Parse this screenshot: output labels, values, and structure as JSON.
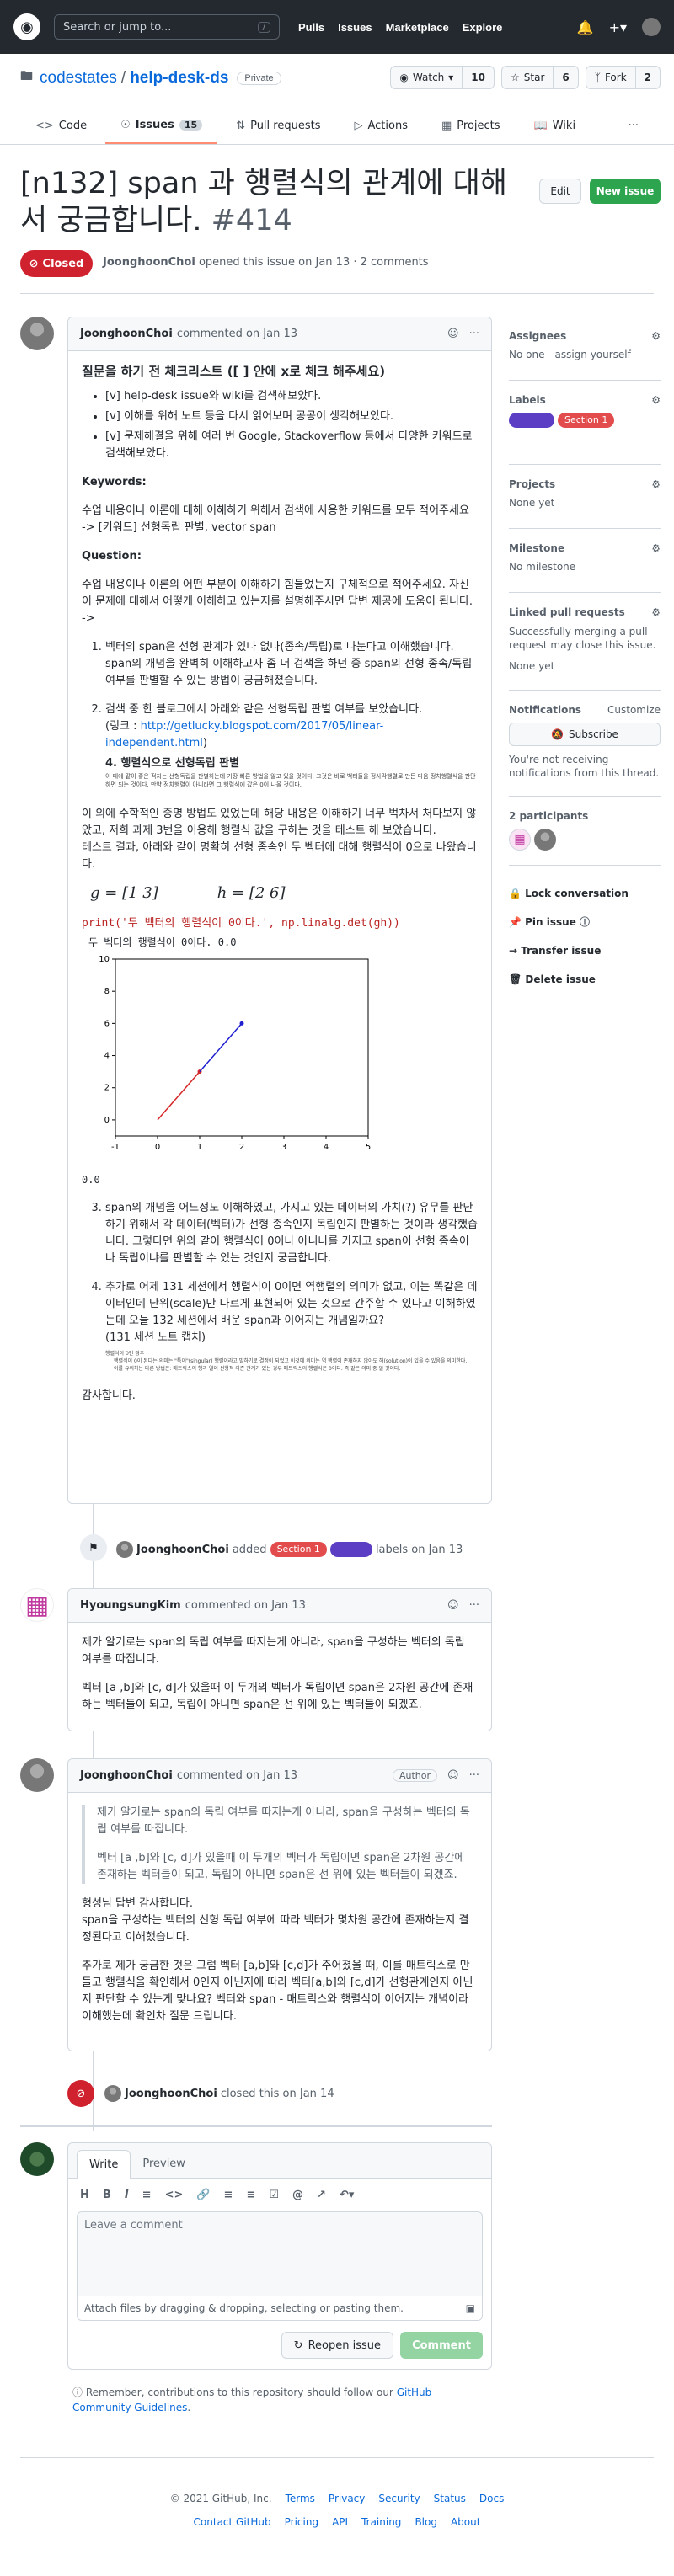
{
  "header": {
    "search_placeholder": "Search or jump to...",
    "slash": "/",
    "nav": [
      "Pulls",
      "Issues",
      "Marketplace",
      "Explore"
    ]
  },
  "repo": {
    "owner": "codestates",
    "name": "help-desk-ds",
    "visibility": "Private",
    "watch": "Watch",
    "watch_count": "10",
    "star": "Star",
    "star_count": "6",
    "fork": "Fork",
    "fork_count": "2"
  },
  "tabs": {
    "code": "Code",
    "issues": "Issues",
    "issues_count": "15",
    "pulls": "Pull requests",
    "actions": "Actions",
    "projects": "Projects",
    "wiki": "Wiki"
  },
  "issue": {
    "title": "[n132] span 과 행렬식의 관계에 대해서 궁금합니다.",
    "number": "#414",
    "state": "Closed",
    "author": "JoonghoonChoi",
    "meta": "opened this issue on Jan 13 · 2 comments",
    "edit": "Edit",
    "new_issue": "New issue"
  },
  "c1": {
    "author": "JoonghoonChoi",
    "when": "commented on Jan 13",
    "h": "질문을 하기 전 체크리스트 ([ ] 안에 x로 체크 해주세요)",
    "check": [
      "[v] help-desk issue와 wiki를 검색해보았다.",
      "[v] 이해를 위해 노트 등을 다시 읽어보며 공공이 생각해보았다.",
      "[v] 문제해결을 위해 여러 번 Google, Stackoverflow 등에서 다양한 키워드로 검색해보았다."
    ],
    "kw_h": "Keywords:",
    "kw_1": "수업 내용이나 이론에 대해 이해하기 위해서 검색에 사용한 키워드를 모두 적어주세요",
    "kw_2": "-> [키워드] 선형독립 판별, vector span",
    "q_h": "Question:",
    "q_p1": "수업 내용이나 이론의 어떤 부분이 이해하기 힘들었는지 구체적으로 적어주세요. 자신이 문제에 대해서 어떻게 이해하고 있는지를 설명해주시면 답변 제공에 도움이 됩니다.",
    "q_arrow": "->",
    "o1": "벡터의 span은 선형 관계가 있나 없나(종속/독립)로 나눈다고 이해했습니다. span의 개념을 완벽히 이해하고자 좀 더 검색을 하던 중 span의 선형 종속/독립 여부를 판별할 수 있는 방법이 궁금해졌습니다.",
    "o2a": "검색 중 한 블로그에서 아래와 같은 선형독립 판별 여부를 보았습니다.",
    "o2b": "(링크 : ",
    "o2link": "http://getlucky.blogspot.com/2017/05/linear-independent.html",
    "o2c": ")",
    "o2img_h": "4. 행렬식으로 선형독립 판별",
    "o2img_t": "이 때에 같이 좋은 적지는 선형독립을 판별하는데 가장 빠른 방법을 알고 있을 것이다. 그것은 바로 백터들을 정사각행렬로 만든 다음 정치행렬식을 판단하면 되는 것이다. 만약 정치행렬이 아니라면 그 행렬식에 값은 0이 나올 것이다.",
    "p3": "이 외에 수학적인 증명 방법도 있었는데 해당 내용은 이해하기 너무 벅차서 처다보지 않았고, 저희 과제 3번을 이용해 행렬식 값을 구하는 것을 테스트 해 보았습니다.",
    "p4": "테스트 결과, 아래와 같이 명확히 선형 종속인 두 벡터에 대해 행렬식이 0으로 나왔습니다.",
    "vec_g": "g = [1   3]",
    "vec_h": "h = [2   6]",
    "code": "print('두 벡터의 행렬식이 0이다.', np.linalg.det(gh))",
    "out": "두 벡터의 행렬식이 0이다. 0.0",
    "out2": "0.0",
    "o3": "span의 개념을 어느정도 이해하였고, 가지고 있는 데이터의 가치(?) 유무를 판단하기 위해서 각 데이터(벡터)가 선형 종속인지 독립인지 판별하는 것이라 생각했습니다. 그렇다면 위와 같이 행렬식이 0이나 아니나를 가지고 span이 선형 종속이나 독립이냐를 판별할 수 있는 것인지 궁금합니다.",
    "o4": "추가로 어제 131 세션에서 행렬식이 0이면 역행렬의 의미가 없고, 이는 똑같은 데이터인데 단위(scale)만 다르게 표현되어 있는 것으로 간주할 수 있다고 이해하였는데 오늘 132 세션에서 배운 span과 이어지는 개념일까요?",
    "o4b": "(131 세션 노트 캡처)",
    "o4img_a": "행렬식이 0인 경우",
    "o4img_b": "행렬식이 0이 된다는 의미는 \"특이\"(singular) 행렬이라고 말하기로 결정이 되었고 이것에 의미는 역 행렬이 존재하지 않아도 해(solution)이 있을 수 있음을 의미한다.",
    "o4img_c": "이를 유의하는 다른 방법은: 매트릭스의 행과 열이 선형적 의존 관계가 있는 경우 매트릭스의 행렬식은 0이다. 즉 같은 의미 중 일 것이다.",
    "thanks": "감사합니다."
  },
  "chart_data": {
    "type": "line",
    "xlim": [
      -1,
      5
    ],
    "ylim": [
      -1,
      10
    ],
    "xticks": [
      -1,
      0,
      1,
      2,
      3,
      4,
      5
    ],
    "yticks": [
      0,
      2,
      4,
      6,
      8,
      10
    ],
    "series": [
      {
        "color": "#d62728",
        "x": [
          0,
          1
        ],
        "y": [
          0,
          3
        ]
      },
      {
        "color": "#1f1fd0",
        "x": [
          1,
          2
        ],
        "y": [
          3,
          6
        ]
      }
    ]
  },
  "sidebar": {
    "assignees": "Assignees",
    "assignees_v": "No one—assign yourself",
    "labels": "Labels",
    "label1": "",
    "label2": "Section 1",
    "projects": "Projects",
    "projects_v": "None yet",
    "milestone": "Milestone",
    "milestone_v": "No milestone",
    "linked": "Linked pull requests",
    "linked_t": "Successfully merging a pull request may close this issue.",
    "linked_v": "None yet",
    "notif": "Notifications",
    "customize": "Customize",
    "subscribe": "Subscribe",
    "notif_t": "You're not receiving notifications from this thread.",
    "participants": "2 participants",
    "lock": "Lock conversation",
    "pin": "Pin issue",
    "transfer": "Transfer issue",
    "delete": "Delete issue"
  },
  "ev1": {
    "author": "JoonghoonChoi",
    "a": "added",
    "l1": "Section 1",
    "l2": "",
    "b": "labels on Jan 13"
  },
  "c2": {
    "author": "HyoungsungKim",
    "when": "commented on Jan 13",
    "p1": "제가 알기로는 span의 독립 여부를 따지는게 아니라, span을 구성하는 벡터의 독립 여부를 따집니다.",
    "p2": "벡터 [a ,b]와 [c, d]가 있을때 이 두개의 벡터가 독립이면 span은 2차원 공간에 존재하는 벡터들이 되고, 독립이 아니면 span은 선 위에 있는 벡터들이 되겠죠."
  },
  "c3": {
    "author": "JoonghoonChoi",
    "when": "commented on Jan 13",
    "badge": "Author",
    "q1": "제가 알기로는 span의 독립 여부를 따지는게 아니라, span을 구성하는 벡터의 독립 여부를 따집니다.",
    "q2": "벡터 [a ,b]와 [c, d]가 있을때 이 두개의 벡터가 독립이면 span은 2차원 공간에 존재하는 벡터들이 되고, 독립이 아니면 span은 선 위에 있는 벡터들이 되겠죠.",
    "p1": "형성님 답변 감사합니다.",
    "p2": "span을 구성하는 벡터의 선형 독립 여부에 따라 벡터가 몇차원 공간에 존재하는지 결정된다고 이해했습니다.",
    "p3": "추가로 제가 궁금한 것은 그럼 벡터 [a,b]와 [c,d]가 주어졌을 때, 이를 매트릭스로 만들고 행렬식을 확인해서 0인지 아닌지에 따라 벡터[a,b]와 [c,d]가 선형관계인지 아닌지 판단할 수 있는게 맞나요? 벡터와 span - 매트릭스와 행렬식이 이어지는 개념이라 이해했는데 확인차 질문 드립니다."
  },
  "ev2": {
    "author": "JoonghoonChoi",
    "b": "closed this on Jan 14"
  },
  "composer": {
    "write": "Write",
    "preview": "Preview",
    "placeholder": "Leave a comment",
    "attach": "Attach files by dragging & dropping, selecting or pasting them.",
    "reopen": "Reopen issue",
    "comment": "Comment"
  },
  "remember": {
    "a": "Remember, contributions to this repository should follow our ",
    "link": "GitHub Community Guidelines",
    "b": "."
  },
  "footer": {
    "copy": "© 2021 GitHub, Inc.",
    "row1": [
      "Terms",
      "Privacy",
      "Security",
      "Status",
      "Docs"
    ],
    "row2": [
      "Contact GitHub",
      "Pricing",
      "API",
      "Training",
      "Blog",
      "About"
    ]
  }
}
